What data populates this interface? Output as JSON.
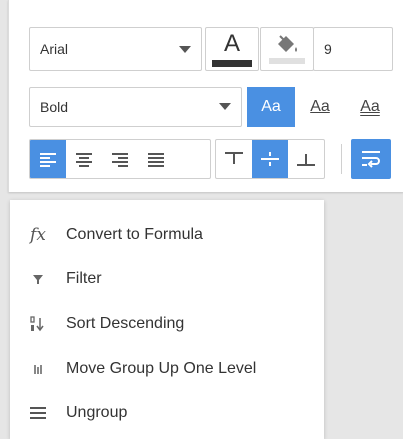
{
  "toolbar": {
    "font_family": {
      "value": "Arial",
      "icon": "chevron-down-icon"
    },
    "font_color": {
      "glyph": "A",
      "swatch_color": "#333333"
    },
    "fill_color": {
      "icon": "paint-bucket-icon"
    },
    "font_size": {
      "value": "9"
    },
    "font_style": {
      "value": "Bold",
      "icon": "chevron-down-icon"
    },
    "text_style_buttons": [
      {
        "label": "Aa",
        "name": "style-normal",
        "active": true
      },
      {
        "label": "Aa",
        "name": "style-underline",
        "active": false
      },
      {
        "label": "Aa",
        "name": "style-double-underline",
        "active": false
      }
    ],
    "horizontal_align": [
      {
        "name": "align-left",
        "active": true
      },
      {
        "name": "align-center",
        "active": false
      },
      {
        "name": "align-right",
        "active": false
      },
      {
        "name": "align-justify",
        "active": false
      }
    ],
    "vertical_align": [
      {
        "name": "align-top",
        "active": false
      },
      {
        "name": "align-middle",
        "active": true
      },
      {
        "name": "align-bottom",
        "active": false
      }
    ],
    "wrap_text": {
      "name": "wrap-text",
      "active": true
    }
  },
  "context_menu": {
    "items": [
      {
        "label": "Convert to Formula",
        "icon": "fx-icon"
      },
      {
        "label": "Filter",
        "icon": "filter-icon"
      },
      {
        "label": "Sort Descending",
        "icon": "sort-descending-icon"
      },
      {
        "label": "Move Group Up One Level",
        "icon": "move-group-up-icon"
      },
      {
        "label": "Ungroup",
        "icon": "ungroup-icon"
      }
    ]
  },
  "colors": {
    "accent": "#4a90e2",
    "border": "#cfcfcf",
    "text": "#333333"
  }
}
